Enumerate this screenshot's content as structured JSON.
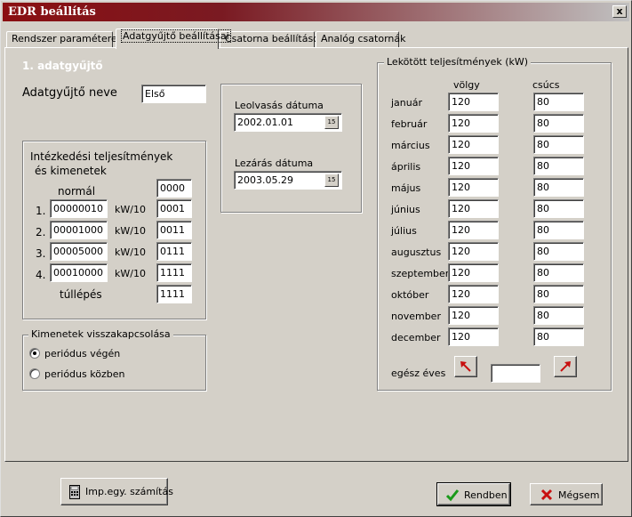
{
  "window": {
    "title": "EDR beállítás",
    "close_glyph": "x"
  },
  "tabs": [
    {
      "label": "Rendszer paraméterek"
    },
    {
      "label": "Adatgyűjtő beállításai"
    },
    {
      "label": "Csatorna beállítások"
    },
    {
      "label": "Analóg csatornák"
    }
  ],
  "collector": {
    "heading": "1. adatgyűjtő",
    "name_label": "Adatgyűjtő neve",
    "name_value": "Első"
  },
  "dates": {
    "read_label": "Leolvasás dátuma",
    "read_value": "2002.01.01",
    "close_label": "Lezárás dátuma",
    "close_value": "2003.05.29",
    "calendar_glyph": "15"
  },
  "limits": {
    "title_line1": "Intézkedési teljesítmények",
    "title_line2": "és kimenetek",
    "normal_label": "normál",
    "normal_output": "0000",
    "rows": [
      {
        "num": "1.",
        "value": "00000010",
        "unit": "kW/10",
        "output": "0001"
      },
      {
        "num": "2.",
        "value": "00001000",
        "unit": "kW/10",
        "output": "0011"
      },
      {
        "num": "3.",
        "value": "00005000",
        "unit": "kW/10",
        "output": "0111"
      },
      {
        "num": "4.",
        "value": "00010000",
        "unit": "kW/10",
        "output": "1111"
      }
    ],
    "exceed_label": "túllépés",
    "exceed_output": "1111"
  },
  "feedback": {
    "legend": "Kimenetek visszakapcsolása",
    "options": [
      {
        "label": "periódus végén",
        "selected": true
      },
      {
        "label": "periódus közben",
        "selected": false
      }
    ]
  },
  "contracted": {
    "legend": "Lekötött teljesítmények (kW)",
    "col_valley": "völgy",
    "col_peak": "csúcs",
    "months": [
      {
        "name": "január",
        "valley": "120",
        "peak": "80"
      },
      {
        "name": "február",
        "valley": "120",
        "peak": "80"
      },
      {
        "name": "március",
        "valley": "120",
        "peak": "80"
      },
      {
        "name": "április",
        "valley": "120",
        "peak": "80"
      },
      {
        "name": "május",
        "valley": "120",
        "peak": "80"
      },
      {
        "name": "június",
        "valley": "120",
        "peak": "80"
      },
      {
        "name": "július",
        "valley": "120",
        "peak": "80"
      },
      {
        "name": "augusztus",
        "valley": "120",
        "peak": "80"
      },
      {
        "name": "szeptember",
        "valley": "120",
        "peak": "80"
      },
      {
        "name": "október",
        "valley": "120",
        "peak": "80"
      },
      {
        "name": "november",
        "valley": "120",
        "peak": "80"
      },
      {
        "name": "december",
        "valley": "120",
        "peak": "80"
      }
    ],
    "whole_year_label": "egész éves",
    "whole_year_value": ""
  },
  "buttons": {
    "imp_label": "Imp.egy. számítás",
    "ok_label": "Rendben",
    "cancel_label": "Mégsem"
  },
  "colors": {
    "title_bar": "#8a0f12",
    "ok_check": "#1a9a1a",
    "cancel_x": "#c81010",
    "arrow": "#c81010"
  }
}
